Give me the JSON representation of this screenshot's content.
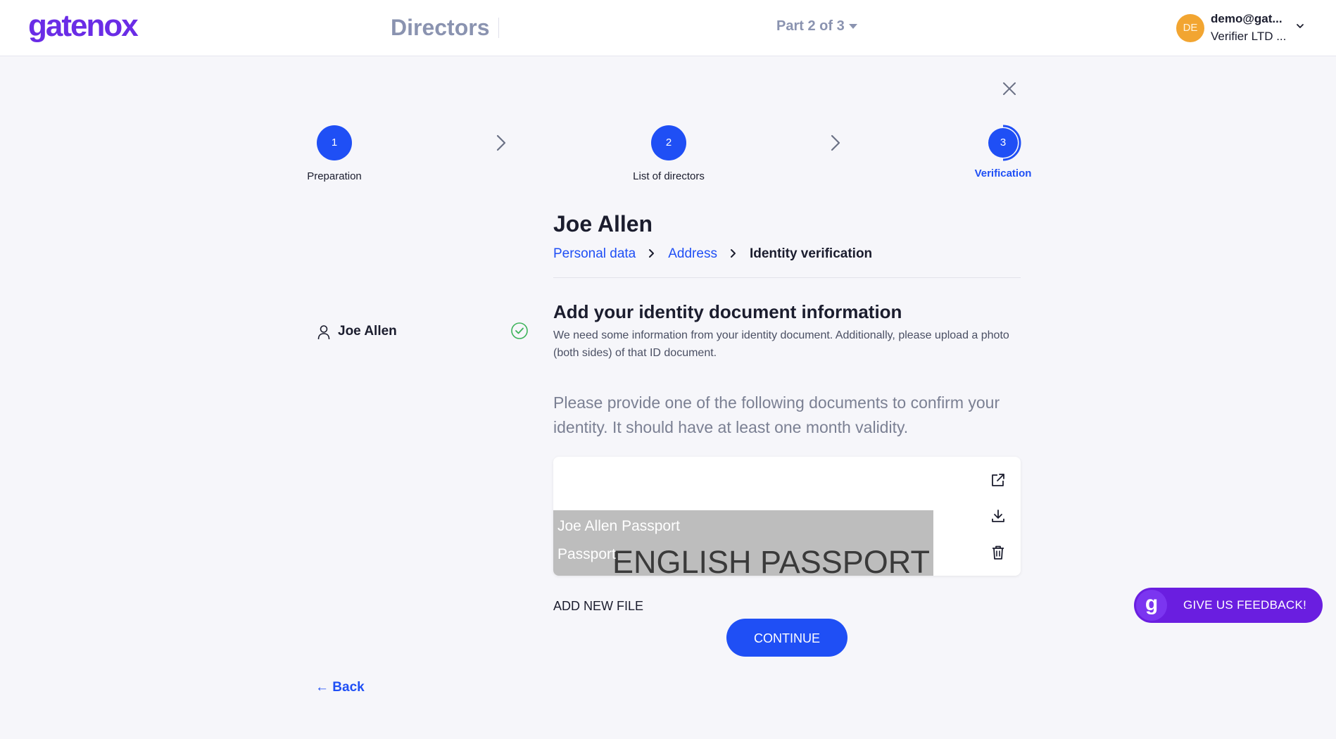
{
  "header": {
    "logo": "gatenox",
    "page_title": "Directors",
    "part_label": "Part 2 of 3",
    "user": {
      "initials": "DE",
      "email": "demo@gat...",
      "company": "Verifier LTD ..."
    }
  },
  "stepper": {
    "steps": [
      {
        "number": "1",
        "label": "Preparation",
        "state": "done"
      },
      {
        "number": "2",
        "label": "List of directors",
        "state": "done"
      },
      {
        "number": "3",
        "label": "Verification",
        "state": "active"
      }
    ]
  },
  "sidebar": {
    "person_name": "Joe Allen",
    "status": "complete"
  },
  "main": {
    "director_name": "Joe Allen",
    "breadcrumb": [
      "Personal data",
      "Address",
      "Identity verification"
    ],
    "section_title": "Add your identity document information",
    "section_desc": "We need some information from your identity document. Additionally, please upload a photo (both sides) of that ID document.",
    "instructions": "Please provide one of the following documents to confirm your identity. It should have at least one month validity.",
    "file": {
      "name": "Joe Allen Passport",
      "type": "Passport",
      "preview_text": "ENGLISH PASSPORT"
    },
    "add_file_label": "ADD NEW FILE",
    "continue_label": "CONTINUE",
    "back_label": "← Back"
  },
  "feedback": {
    "logo_letter": "g",
    "label": "GIVE US FEEDBACK!"
  },
  "colors": {
    "primary": "#1f4ff5",
    "brand": "#6a2ce6",
    "avatar": "#f2a531",
    "success": "#3db35a",
    "background": "#f6f6fa"
  }
}
